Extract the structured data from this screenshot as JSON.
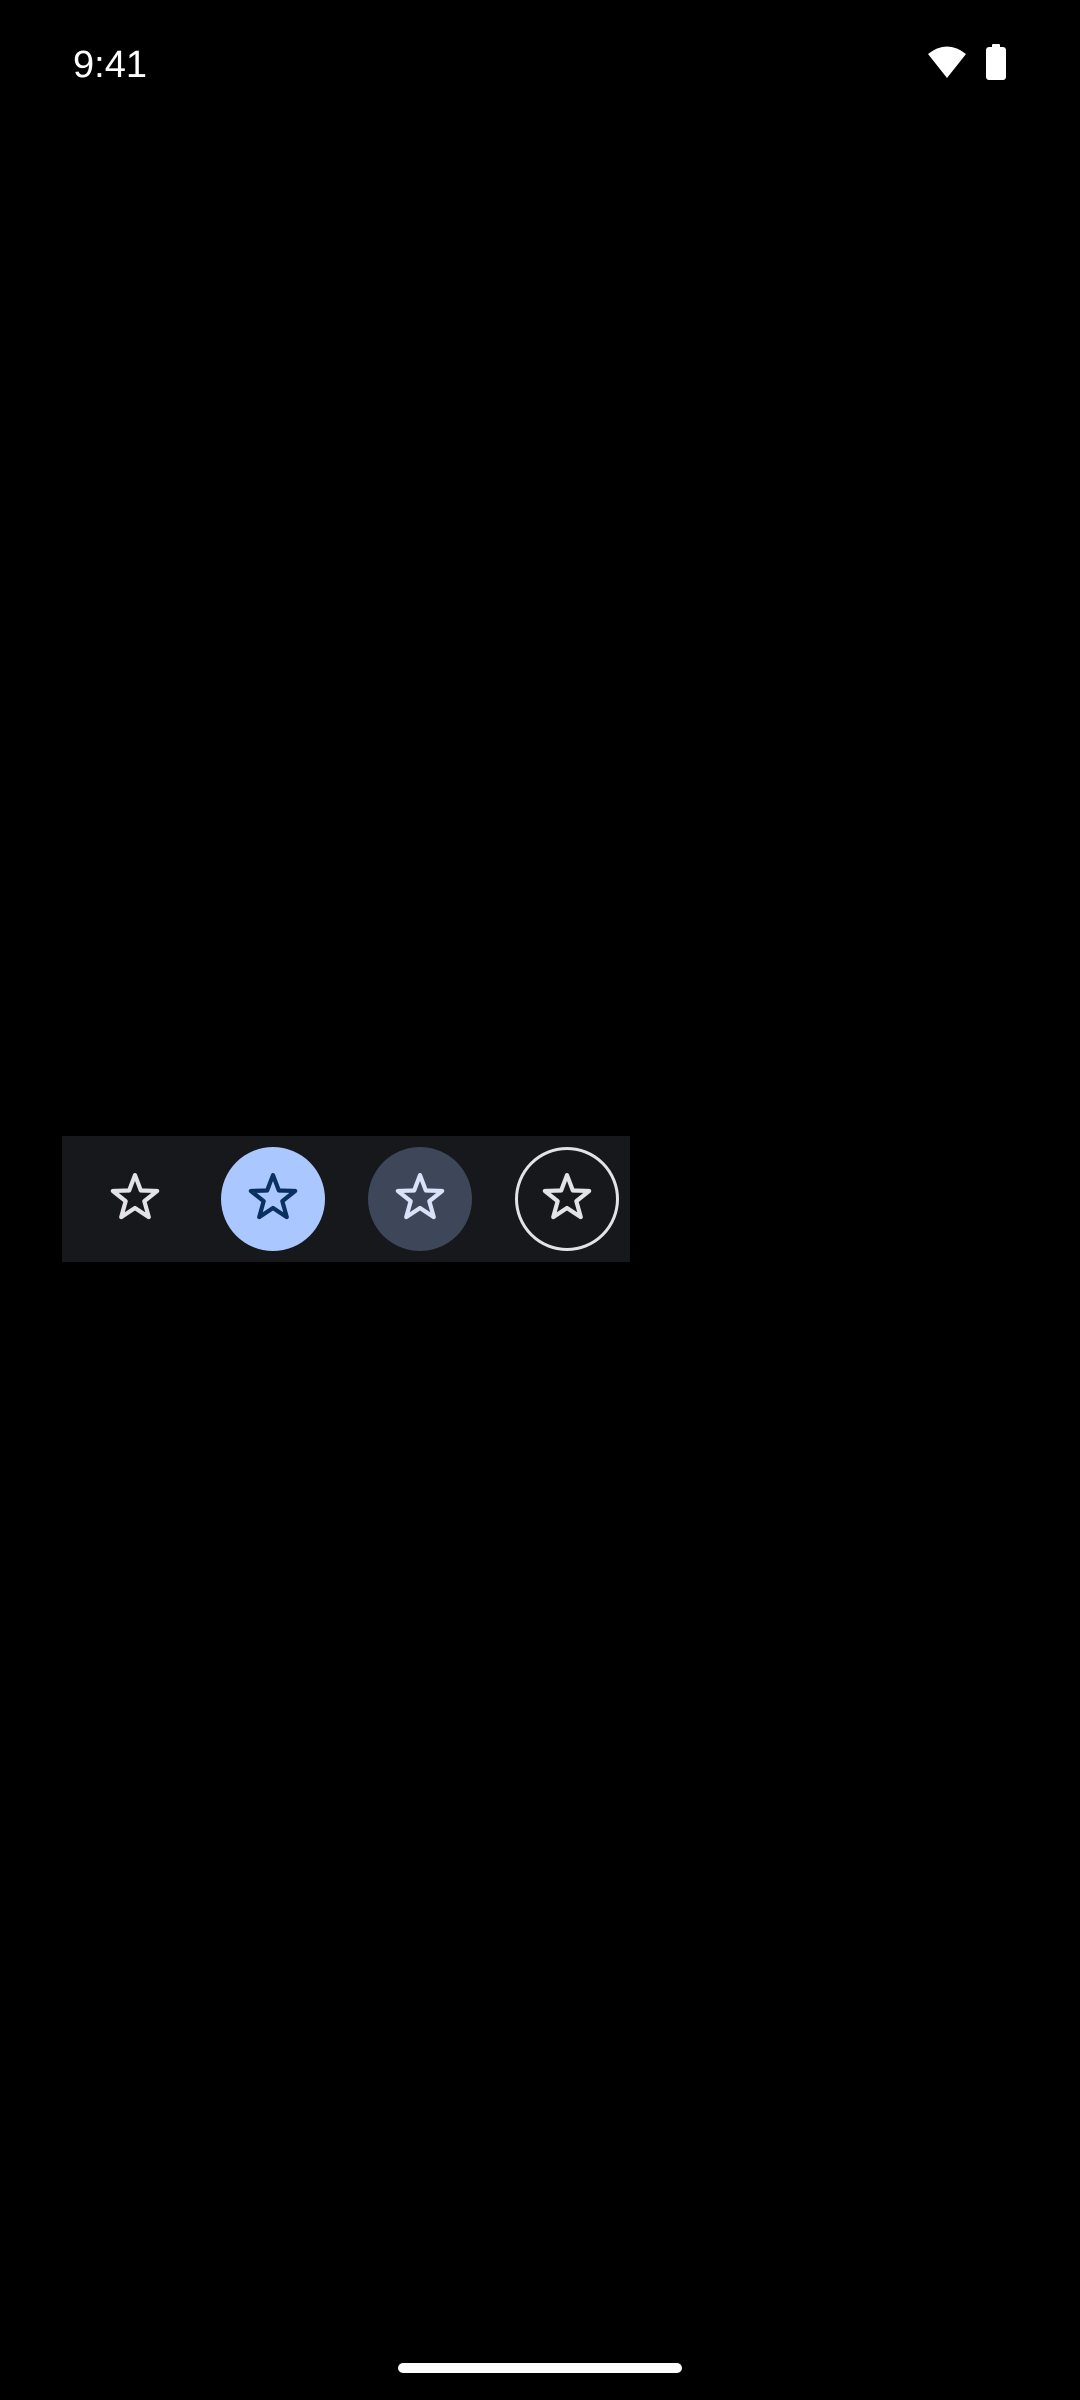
{
  "status_bar": {
    "time": "9:41",
    "icons": [
      "wifi-icon",
      "battery-icon"
    ]
  },
  "icon_buttons": [
    {
      "name": "standard-icon-button",
      "icon": "star-outline-icon",
      "style": "standard"
    },
    {
      "name": "filled-icon-button",
      "icon": "star-outline-icon",
      "style": "filled"
    },
    {
      "name": "tonal-icon-button",
      "icon": "star-outline-icon",
      "style": "filled-tonal"
    },
    {
      "name": "outlined-icon-button",
      "icon": "star-outline-icon",
      "style": "outlined"
    }
  ],
  "colors": {
    "background": "#000000",
    "row_surface": "#17181c",
    "on_surface": "#e3e3e6",
    "filled_container": "#aac7ff",
    "filled_icon": "#0a305f",
    "tonal_container": "#3e4759",
    "tonal_icon": "#dae2f9",
    "outline": "#e3e3e6",
    "gesture_bar": "#ffffff"
  }
}
